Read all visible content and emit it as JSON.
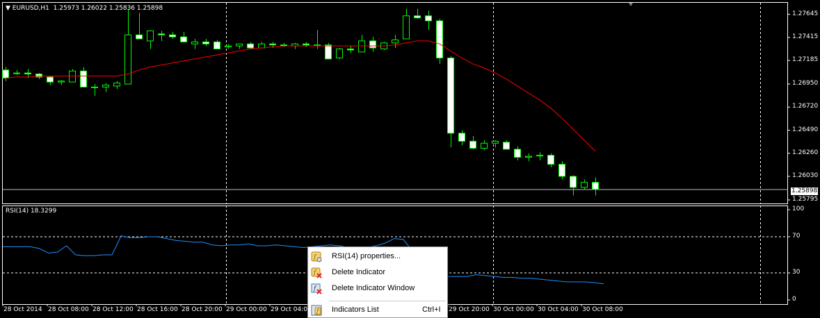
{
  "header": {
    "symbol": "EURUSD,H1",
    "ohlc": "1.25973 1.26022 1.25836 1.25898"
  },
  "price_axis": {
    "ticks": [
      "1.27645",
      "1.27415",
      "1.27185",
      "1.26950",
      "1.26720",
      "1.26490",
      "1.26260",
      "1.26030",
      "1.25795"
    ],
    "current": "1.25898"
  },
  "rsi": {
    "label": "RSI(14) 18.3299",
    "levels": [
      "100",
      "70",
      "30",
      "0"
    ]
  },
  "time_axis": [
    "28 Oct 2014",
    "28 Oct 08:00",
    "28 Oct 12:00",
    "28 Oct 16:00",
    "28 Oct 20:00",
    "29 Oct 00:00",
    "29 Oct 04:00",
    "29 Oct 20:00",
    "30 Oct 00:00",
    "30 Oct 04:00",
    "30 Oct 08:00"
  ],
  "context_menu": {
    "items": [
      {
        "label": "RSI(14) properties...",
        "shortcut": ""
      },
      {
        "label": "Delete Indicator",
        "shortcut": ""
      },
      {
        "label": "Delete Indicator Window",
        "shortcut": ""
      },
      {
        "label": "Indicators List",
        "shortcut": "Ctrl+I"
      }
    ]
  },
  "colors": {
    "background": "#000000",
    "bull_body": "#000000",
    "bear_body": "#ffffff",
    "wick": "#00ff00",
    "ma": "#ff0000",
    "rsi": "#1e90ff",
    "grid": "#ffffff"
  },
  "chart_data": [
    {
      "type": "candlestick",
      "symbol": "EURUSD",
      "timeframe": "H1",
      "ylim": [
        1.2576,
        1.2776
      ],
      "x_labels": [
        "28 Oct 2014",
        "28 Oct 08:00",
        "28 Oct 12:00",
        "28 Oct 16:00",
        "28 Oct 20:00",
        "29 Oct 00:00",
        "29 Oct 04:00",
        "29 Oct 20:00",
        "30 Oct 00:00",
        "30 Oct 04:00",
        "30 Oct 08:00"
      ],
      "candles": [
        [
          1.2709,
          1.2712,
          1.2698,
          1.2701
        ],
        [
          1.2706,
          1.2709,
          1.2704,
          1.2706
        ],
        [
          1.2706,
          1.271,
          1.2701,
          1.2705
        ],
        [
          1.2705,
          1.2706,
          1.27,
          1.2702
        ],
        [
          1.2702,
          1.2703,
          1.2694,
          1.2697
        ],
        [
          1.2697,
          1.2699,
          1.2694,
          1.2698
        ],
        [
          1.2697,
          1.271,
          1.2697,
          1.2708
        ],
        [
          1.2708,
          1.2712,
          1.2692,
          1.2692
        ],
        [
          1.2692,
          1.2695,
          1.2683,
          1.2692
        ],
        [
          1.2692,
          1.2696,
          1.2687,
          1.2694
        ],
        [
          1.2693,
          1.2698,
          1.269,
          1.2696
        ],
        [
          1.2695,
          1.277,
          1.2695,
          1.2744
        ],
        [
          1.2744,
          1.2766,
          1.274,
          1.274
        ],
        [
          1.2738,
          1.2748,
          1.273,
          1.2748
        ],
        [
          1.2745,
          1.2748,
          1.2738,
          1.2744
        ],
        [
          1.2744,
          1.2747,
          1.274,
          1.2742
        ],
        [
          1.2742,
          1.2747,
          1.2737,
          1.2737
        ],
        [
          1.2735,
          1.274,
          1.273,
          1.2737
        ],
        [
          1.2737,
          1.274,
          1.2733,
          1.2735
        ],
        [
          1.2737,
          1.2739,
          1.2731,
          1.273
        ],
        [
          1.2732,
          1.2735,
          1.273,
          1.2733
        ],
        [
          1.2733,
          1.2735,
          1.273,
          1.2735
        ],
        [
          1.2735,
          1.2737,
          1.273,
          1.2731
        ],
        [
          1.2731,
          1.2737,
          1.2731,
          1.2735
        ],
        [
          1.2735,
          1.2737,
          1.2731,
          1.2734
        ],
        [
          1.2734,
          1.2736,
          1.2732,
          1.2733
        ],
        [
          1.2733,
          1.2736,
          1.273,
          1.2735
        ],
        [
          1.2735,
          1.2737,
          1.2732,
          1.2734
        ],
        [
          1.2734,
          1.2749,
          1.273,
          1.2734
        ],
        [
          1.2734,
          1.2736,
          1.272,
          1.272
        ],
        [
          1.2721,
          1.2731,
          1.272,
          1.273
        ],
        [
          1.273,
          1.2733,
          1.2726,
          1.2729
        ],
        [
          1.2727,
          1.2744,
          1.2727,
          1.2738
        ],
        [
          1.2738,
          1.2742,
          1.2727,
          1.2731
        ],
        [
          1.273,
          1.2737,
          1.2729,
          1.2736
        ],
        [
          1.2736,
          1.2744,
          1.2731,
          1.2739
        ],
        [
          1.274,
          1.277,
          1.274,
          1.2763
        ],
        [
          1.2763,
          1.277,
          1.276,
          1.2761
        ],
        [
          1.2763,
          1.2768,
          1.2749,
          1.2758
        ],
        [
          1.2758,
          1.276,
          1.2715,
          1.2721
        ],
        [
          1.2721,
          1.2723,
          1.2632,
          1.2646
        ],
        [
          1.2646,
          1.2649,
          1.2634,
          1.2638
        ],
        [
          1.2638,
          1.2643,
          1.263,
          1.2631
        ],
        [
          1.2631,
          1.2639,
          1.2629,
          1.2636
        ],
        [
          1.2636,
          1.2639,
          1.2632,
          1.2638
        ],
        [
          1.2637,
          1.2639,
          1.263,
          1.263
        ],
        [
          1.263,
          1.2633,
          1.2619,
          1.2622
        ],
        [
          1.2622,
          1.2626,
          1.2618,
          1.2623
        ],
        [
          1.2624,
          1.2627,
          1.2619,
          1.2624
        ],
        [
          1.2624,
          1.2626,
          1.2612,
          1.2615
        ],
        [
          1.2615,
          1.2618,
          1.26,
          1.2603
        ],
        [
          1.2603,
          1.2604,
          1.2584,
          1.2592
        ],
        [
          1.2592,
          1.26,
          1.259,
          1.2597
        ],
        [
          1.2597,
          1.2602,
          1.2584,
          1.259
        ]
      ],
      "ma": [
        1.2701,
        1.2702,
        1.2702,
        1.2703,
        1.2703,
        1.2703,
        1.2703,
        1.2703,
        1.2703,
        1.2703,
        1.2703,
        1.2705,
        1.2709,
        1.2712,
        1.2714,
        1.2716,
        1.2718,
        1.272,
        1.2722,
        1.2724,
        1.2726,
        1.2728,
        1.273,
        1.2731,
        1.2732,
        1.2733,
        1.2733,
        1.2733,
        1.2733,
        1.2733,
        1.2733,
        1.2733,
        1.2733,
        1.2733,
        1.2733,
        1.2734,
        1.2736,
        1.2738,
        1.2738,
        1.2735,
        1.2728,
        1.2721,
        1.2715,
        1.2711,
        1.2706,
        1.27,
        1.2693,
        1.2686,
        1.2679,
        1.2671,
        1.2661,
        1.265,
        1.2639,
        1.2628
      ],
      "current_price": 1.25898
    },
    {
      "type": "line",
      "name": "RSI(14)",
      "value": 18.3299,
      "ylim": [
        0,
        100
      ],
      "levels": [
        70,
        30
      ],
      "values": [
        59,
        59,
        59,
        59,
        57,
        52,
        53,
        60,
        50,
        49,
        49,
        50,
        50,
        71,
        69,
        69,
        70,
        70,
        68,
        66,
        65,
        64,
        64,
        61,
        60,
        61,
        61,
        62,
        60,
        60,
        61,
        60,
        59,
        58,
        59,
        60,
        61,
        60,
        58,
        57,
        58,
        60,
        63,
        68,
        67,
        54,
        27,
        26,
        26,
        26,
        26,
        26,
        28,
        27,
        26,
        25,
        25,
        24,
        24,
        23,
        22,
        21,
        20,
        20,
        20,
        19,
        18
      ]
    }
  ]
}
